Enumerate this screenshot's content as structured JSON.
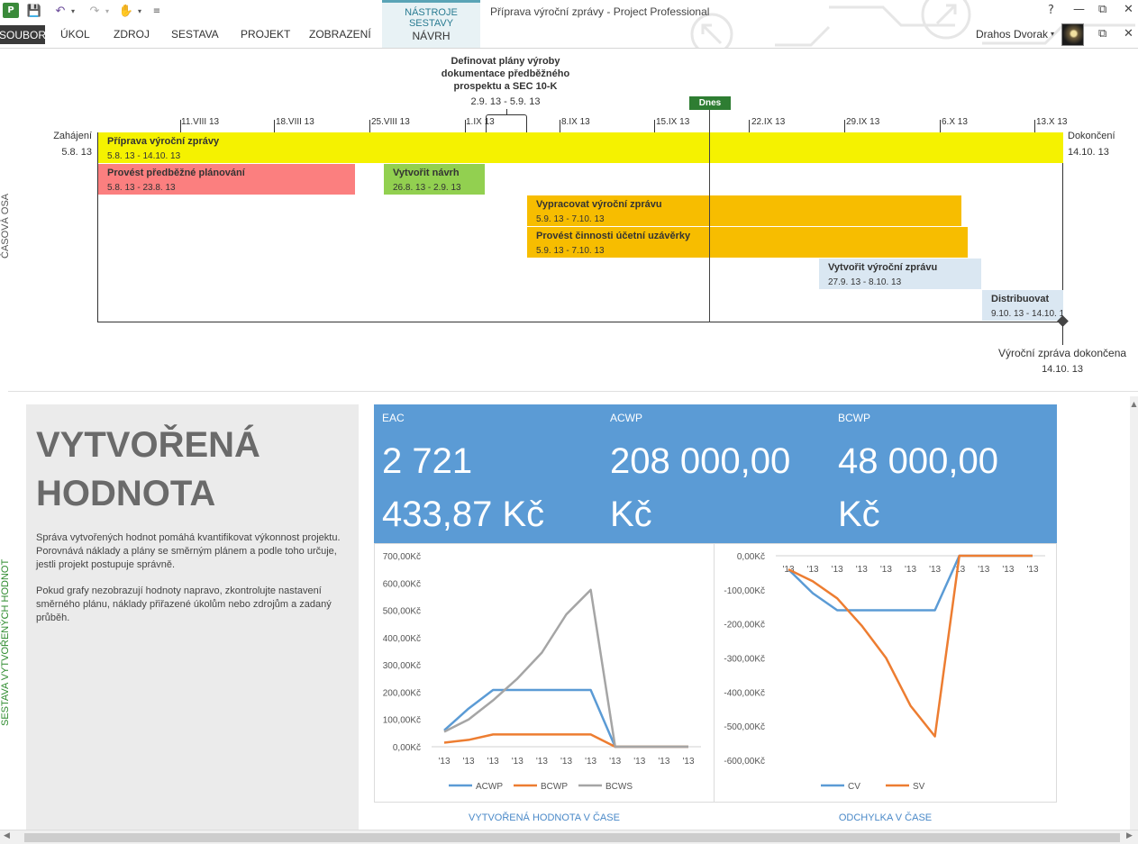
{
  "app": {
    "title": "Příprava výroční zprávy - Project Professional",
    "icon_label": "P",
    "user": "Drahos Dvorak",
    "context_tab_group": "NÁSTROJE SESTAVY",
    "context_tab": "NÁVRH",
    "tabs": [
      "SOUBOR",
      "ÚKOL",
      "ZDROJ",
      "SESTAVA",
      "PROJEKT",
      "ZOBRAZENÍ"
    ],
    "window_buttons": {
      "help": "?",
      "restore": "⧉",
      "close": "✕",
      "minimize_ribbon": "▭",
      "restore2": "⧉",
      "close2": "✕"
    },
    "user_dropdown": "▾"
  },
  "views": {
    "timeline_label": "ČASOVÁ OSA",
    "report_label": "SESTAVA VYTVOŘENÝCH HODNOT"
  },
  "timeline": {
    "start_label": "Zahájení",
    "start_date": "5.8. 13",
    "finish_label": "Dokončení",
    "finish_date": "14.10. 13",
    "today": "Dnes",
    "ticks": [
      "11.VIII 13",
      "18.VIII 13",
      "25.VIII 13",
      "1.IX 13",
      "8.IX 13",
      "15.IX 13",
      "22.IX 13",
      "29.IX 13",
      "6.X 13",
      "13.X 13"
    ],
    "callout": {
      "name": "Definovat plány výroby dokumentace předběžného prospektu a SEC 10-K",
      "dates": "2.9. 13 - 5.9. 13"
    },
    "bars": [
      {
        "name": "Příprava výroční zprávy",
        "dates": "5.8. 13 - 14.10. 13",
        "color": "#f5f200"
      },
      {
        "name": "Provést předběžné plánování",
        "dates": "5.8. 13 - 23.8. 13",
        "color": "#fb7f7f"
      },
      {
        "name": "Vytvořit návrh",
        "dates": "26.8. 13 - 2.9. 13",
        "color": "#92d050"
      },
      {
        "name": "Vypracovat výroční zprávu",
        "dates": "5.9. 13 - 7.10. 13",
        "color": "#f7bd00"
      },
      {
        "name": "Provést činnosti účetní uzávěrky",
        "dates": "5.9. 13 - 7.10. 13",
        "color": "#f7bd00"
      },
      {
        "name": "Vytvořit výroční zprávu",
        "dates": "27.9. 13 - 8.10. 13",
        "color": "#dae7f2"
      },
      {
        "name": "Distribuovat",
        "dates": "9.10. 13 - 14.10. 13",
        "color": "#dae7f2"
      }
    ],
    "milestone": {
      "name": "Výroční zpráva dokončena",
      "date": "14.10. 13"
    }
  },
  "report": {
    "title_line1": "VYTVOŘENÁ",
    "title_line2": "HODNOTA",
    "paragraph1": "Správa vytvořených hodnot pomáhá kvantifikovat výkonnost projektu. Porovnává náklady a plány se směrným plánem a podle toho určuje, jestli projekt postupuje správně.",
    "paragraph2": "Pokud grafy nezobrazují hodnoty napravo, zkontrolujte nastavení směrného plánu, náklady přiřazené úkolům nebo zdrojům a zadaný průběh.",
    "kpis": [
      {
        "label": "EAC",
        "value_line1": "2 721",
        "value_line2": "433,87 Kč"
      },
      {
        "label": "ACWP",
        "value_line1": "208 000,00",
        "value_line2": "Kč"
      },
      {
        "label": "BCWP",
        "value_line1": "48 000,00",
        "value_line2": "Kč"
      }
    ],
    "chart_captions": [
      "VYTVOŘENÁ HODNOTA V ČASE",
      "ODCHYLKA V ČASE"
    ]
  },
  "chart_data": [
    {
      "type": "line",
      "title": "VYTVOŘENÁ HODNOTA V ČASE",
      "categories": [
        "'13",
        "'13",
        "'13",
        "'13",
        "'13",
        "'13",
        "'13",
        "'13",
        "'13",
        "'13",
        "'13"
      ],
      "ytick_labels": [
        "0,00Kč",
        "100,00Kč",
        "200,00Kč",
        "300,00Kč",
        "400,00Kč",
        "500,00Kč",
        "600,00Kč",
        "700,00Kč"
      ],
      "ylim": [
        0,
        700
      ],
      "series": [
        {
          "name": "ACWP",
          "color": "#5b9bd5",
          "values": [
            60,
            140,
            208,
            208,
            208,
            208,
            208,
            0,
            0,
            0,
            0
          ]
        },
        {
          "name": "BCWP",
          "color": "#ed7d31",
          "values": [
            15,
            25,
            45,
            45,
            45,
            45,
            45,
            0,
            0,
            0,
            0
          ]
        },
        {
          "name": "BCWS",
          "color": "#a5a5a5",
          "values": [
            55,
            100,
            170,
            250,
            345,
            485,
            575,
            0,
            0,
            0,
            0
          ]
        }
      ],
      "legend": "bottom"
    },
    {
      "type": "line",
      "title": "ODCHYLKA V ČASE",
      "categories": [
        "'13",
        "'13",
        "'13",
        "'13",
        "'13",
        "'13",
        "'13",
        "'13",
        "'13",
        "'13",
        "'13"
      ],
      "ytick_labels": [
        "0,00Kč",
        "-100,00Kč",
        "-200,00Kč",
        "-300,00Kč",
        "-400,00Kč",
        "-500,00Kč",
        "-600,00Kč"
      ],
      "ylim": [
        -600,
        0
      ],
      "series": [
        {
          "name": "CV",
          "color": "#5b9bd5",
          "values": [
            -40,
            -110,
            -160,
            -160,
            -160,
            -160,
            -160,
            0,
            0,
            0,
            0
          ]
        },
        {
          "name": "SV",
          "color": "#ed7d31",
          "values": [
            -40,
            -75,
            -125,
            -205,
            -300,
            -440,
            -530,
            0,
            0,
            0,
            0
          ]
        }
      ],
      "legend": "bottom"
    }
  ]
}
